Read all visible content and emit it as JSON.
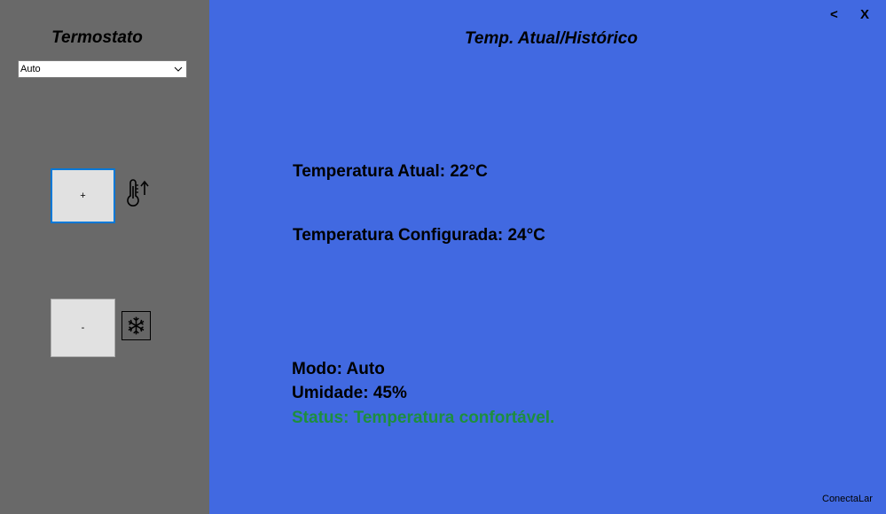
{
  "sidebar": {
    "title": "Termostato",
    "mode_select": {
      "value": "Auto"
    },
    "increase_button_label": "+",
    "decrease_button_label": "-"
  },
  "header": {
    "title": "Temp. Atual/Histórico",
    "back_label": "<",
    "close_label": "X"
  },
  "main": {
    "temp_current": "Temperatura Atual: 22°C",
    "temp_configured": "Temperatura Configurada: 24°C",
    "mode": "Modo: Auto",
    "humidity": "Umidade: 45%",
    "status": "Status: Temperatura confortável."
  },
  "footer": {
    "brand": "ConectaLar"
  },
  "icons": {
    "heat": "thermometer-up-icon",
    "cool": "snowflake-icon",
    "dropdown": "chevron-down-icon"
  },
  "colors": {
    "sidebar_bg": "#696969",
    "main_bg": "#4169e1",
    "status_ok": "#1e8e3e",
    "button_focus": "#0078d7"
  }
}
